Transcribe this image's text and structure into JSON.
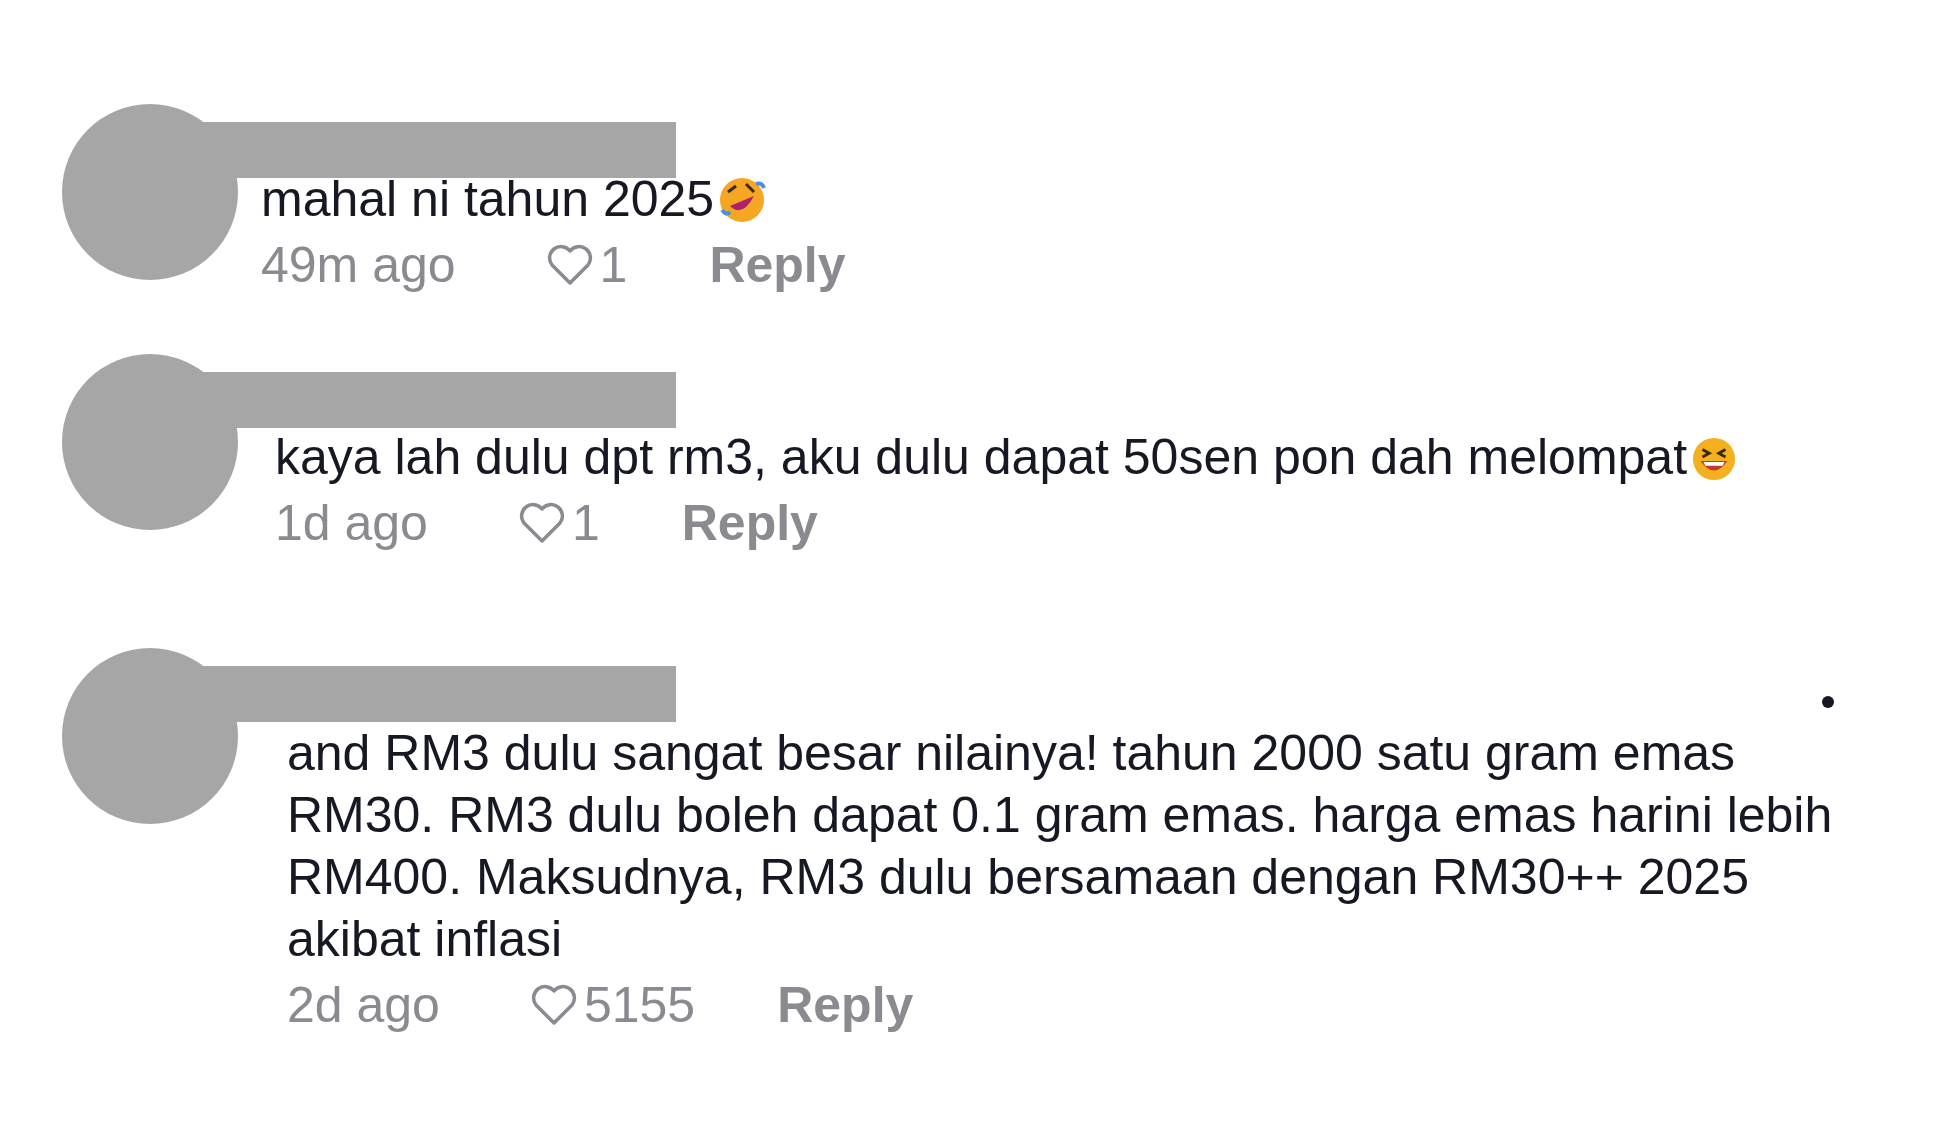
{
  "comments": [
    {
      "text": "mahal ni tahun 2025",
      "kind": "rofl-emoji",
      "time": "49m ago",
      "likes": "1",
      "reply": "Reply",
      "more": false
    },
    {
      "text": "kaya lah dulu dpt rm3, aku dulu dapat 50sen pon dah melompat",
      "kind": "grin-emoji",
      "time": "1d ago",
      "likes": "1",
      "reply": "Reply",
      "more": false
    },
    {
      "text": "and RM3 dulu sangat besar nilainya! tahun 2000 satu gram emas RM30. RM3 dulu boleh dapat 0.1 gram emas. harga emas harini lebih RM400. Maksudnya, RM3 dulu bersamaan dengan RM30++ 2025 akibat inflasi",
      "kind": "plain",
      "time": "2d ago",
      "likes": "5155",
      "reply": "Reply",
      "more": true
    }
  ]
}
